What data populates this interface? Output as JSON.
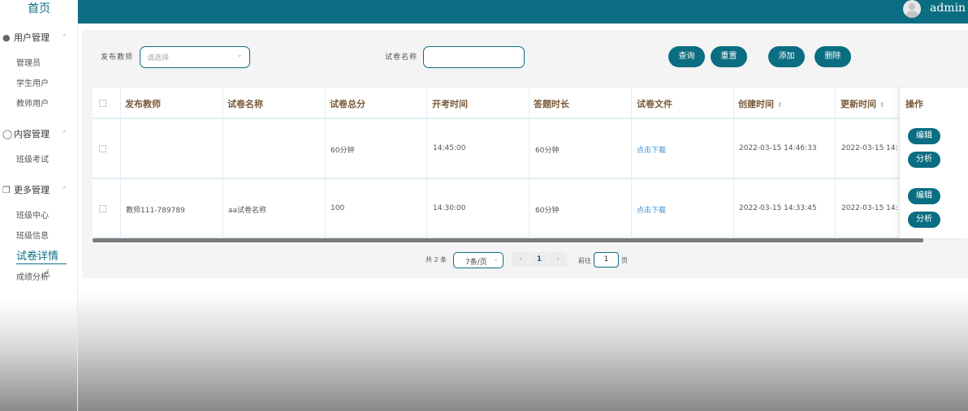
{
  "sidebar": {
    "home": "首页",
    "groups": [
      {
        "label": "用户管理",
        "icon": "user-icon",
        "items": [
          "管理员",
          "学生用户",
          "教师用户"
        ]
      },
      {
        "label": "内容管理",
        "icon": "chat-icon",
        "items": [
          "班级考试"
        ]
      },
      {
        "label": "更多管理",
        "icon": "copy-icon",
        "items": [
          "班级中心",
          "班级信息",
          "试卷详情",
          "成绩分析"
        ]
      }
    ],
    "active_item": "试卷详情"
  },
  "header": {
    "username": "admin",
    "avatar_icon": "avatar-icon"
  },
  "filters": {
    "teacher_label": "发布教师",
    "teacher_placeholder": "请选择",
    "paper_label": "试卷名称",
    "paper_value": ""
  },
  "buttons": {
    "query": "查询",
    "reset": "重置",
    "add": "添加",
    "delete": "删除"
  },
  "table": {
    "columns": [
      "发布教师",
      "试卷名称",
      "试卷总分",
      "开考时间",
      "答题时长",
      "试卷文件",
      "创建时间",
      "更新时间",
      "操作"
    ],
    "rows": [
      {
        "teacher": "",
        "paper_name": "",
        "total_score": "60分钟",
        "start_time": "14:45:00",
        "duration": "60分钟",
        "file": "点击下载",
        "created": "2022-03-15 14:46:33",
        "updated": "2022-03-15 14:",
        "edit": "编辑",
        "analyze": "分析"
      },
      {
        "teacher": "教师111-789789",
        "paper_name": "aa试卷名称",
        "total_score": "100",
        "start_time": "14:30:00",
        "duration": "60分钟",
        "file": "点击下载",
        "created": "2022-03-15 14:33:45",
        "updated": "2022-03-15 14:",
        "edit": "编辑",
        "analyze": "分析"
      }
    ]
  },
  "pagination": {
    "total": "共 2 条",
    "page_size": "7条/页",
    "current_page": "1",
    "goto_label": "前往",
    "goto_value": "1",
    "page_suffix": "页"
  },
  "colors": {
    "primary": "#0b6d82",
    "header_text": "#7a5a3a",
    "link": "#3a8fd8"
  }
}
